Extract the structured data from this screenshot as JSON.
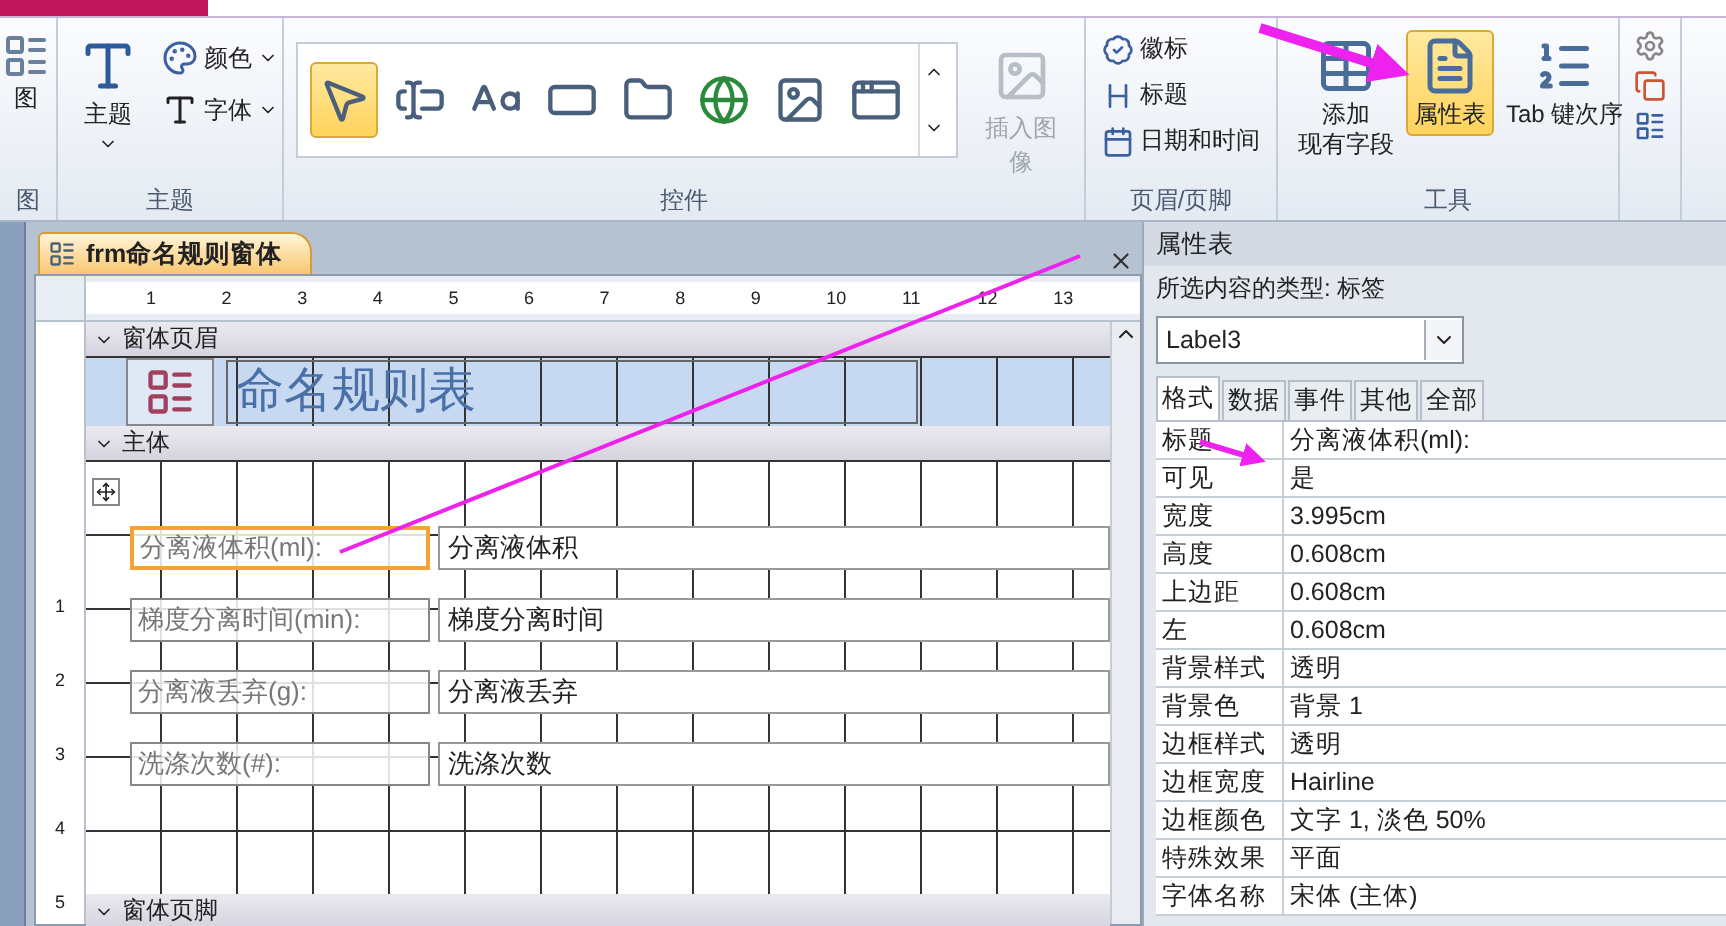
{
  "ribbon": {
    "groups": [
      {
        "kind": "view",
        "label": "图",
        "buttons": [
          {
            "label": "图"
          }
        ]
      },
      {
        "kind": "theme",
        "label": "主题",
        "big": {
          "label": "主题"
        },
        "small": [
          {
            "label": "颜色"
          },
          {
            "label": "字体"
          }
        ]
      },
      {
        "kind": "controls",
        "label": "控件",
        "gallery": [
          {
            "selected": true
          },
          {
            "selected": false
          },
          {
            "selected": false
          },
          {
            "selected": false
          },
          {
            "selected": false
          },
          {
            "selected": false
          },
          {
            "selected": false
          },
          {
            "selected": false
          }
        ],
        "insert": {
          "label": "插入图像",
          "disabled": true
        }
      },
      {
        "kind": "headerfooter",
        "label": "页眉/页脚",
        "items": [
          {
            "label": "徽标"
          },
          {
            "label": "标题"
          },
          {
            "label": "日期和时间"
          }
        ]
      },
      {
        "kind": "tools",
        "label": "工具",
        "buttons": [
          {
            "label_lines": [
              "添加",
              "现有字段"
            ],
            "selected": false
          },
          {
            "label_lines": [
              "属性表"
            ],
            "selected": true
          },
          {
            "label_lines": [
              "Tab 键次序"
            ],
            "selected": false
          }
        ]
      }
    ]
  },
  "document": {
    "tab": "frm命名规则窗体",
    "ruler": [
      "1",
      "2",
      "3",
      "4",
      "5",
      "6",
      "7",
      "8",
      "9",
      "10",
      "11",
      "12",
      "13"
    ],
    "vruler": [
      "1",
      "2",
      "3",
      "4",
      "5"
    ],
    "sections": {
      "header": "窗体页眉",
      "detail": "主体",
      "footer": "窗体页脚"
    },
    "title_label": "命名规则表",
    "controls": [
      {
        "label": "分离液体积(ml):",
        "field": "分离液体积",
        "selected": true
      },
      {
        "label": "梯度分离时间(min):",
        "field": "梯度分离时间",
        "selected": false
      },
      {
        "label": "分离液丢弃(g):",
        "field": "分离液丢弃",
        "selected": false
      },
      {
        "label": "洗涤次数(#):",
        "field": "洗涤次数",
        "selected": false
      }
    ]
  },
  "property_sheet": {
    "title": "属性表",
    "selection_type": "所选内容的类型: 标签",
    "object": "Label3",
    "tabs": [
      {
        "label": "格式",
        "selected": true
      },
      {
        "label": "数据",
        "selected": false
      },
      {
        "label": "事件",
        "selected": false
      },
      {
        "label": "其他",
        "selected": false
      },
      {
        "label": "全部",
        "selected": false
      }
    ],
    "rows": [
      {
        "name": "标题",
        "value": "分离液体积(ml):"
      },
      {
        "name": "可见",
        "value": "是"
      },
      {
        "name": "宽度",
        "value": "3.995cm"
      },
      {
        "name": "高度",
        "value": "0.608cm"
      },
      {
        "name": "上边距",
        "value": "0.608cm"
      },
      {
        "name": "左",
        "value": "0.608cm"
      },
      {
        "name": "背景样式",
        "value": "透明"
      },
      {
        "name": "背景色",
        "value": "背景 1"
      },
      {
        "name": "边框样式",
        "value": "透明"
      },
      {
        "name": "边框宽度",
        "value": "Hairline"
      },
      {
        "name": "边框颜色",
        "value": "文字 1, 淡色 50%"
      },
      {
        "name": "特殊效果",
        "value": "平面"
      },
      {
        "name": "字体名称",
        "value": "宋体 (主体)"
      }
    ]
  }
}
